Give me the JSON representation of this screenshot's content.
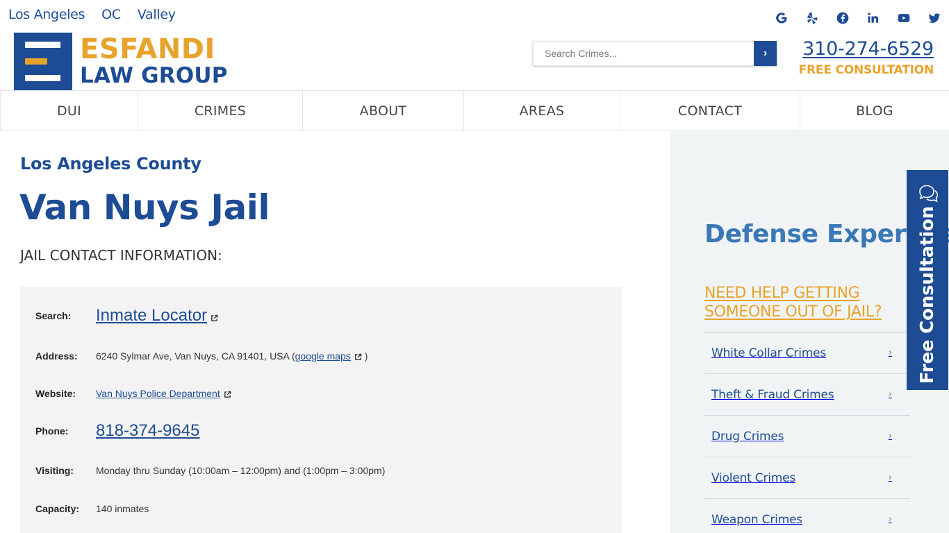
{
  "top_bar": {
    "regions": [
      "Los Angeles",
      "OC",
      "Valley"
    ],
    "social_icons": [
      "google-icon",
      "yelp-icon",
      "facebook-icon",
      "linkedin-icon",
      "youtube-icon",
      "twitter-icon"
    ]
  },
  "logo": {
    "line1": "ESFANDI",
    "line2": "LAW GROUP"
  },
  "search": {
    "placeholder": "Search Crimes...",
    "button_label": "›"
  },
  "contact": {
    "phone": "310-274-6529",
    "tagline": "FREE CONSULTATION"
  },
  "nav": {
    "items": [
      "DUI",
      "CRIMES",
      "ABOUT",
      "AREAS",
      "CONTACT",
      "BLOG"
    ]
  },
  "main": {
    "eyebrow": "Los Angeles County",
    "title": "Van Nuys Jail",
    "section_heading": "JAIL CONTACT INFORMATION:",
    "info": {
      "search_label": "Search:",
      "search_value": "Inmate Locator",
      "address_label": "Address:",
      "address_value": "6240 Sylmar Ave, Van Nuys, CA 91401, USA (",
      "address_link": "google maps",
      "address_close": ")",
      "website_label": "Website:",
      "website_value": "Van Nuys Police Department",
      "phone_label": "Phone:",
      "phone_value": "818-374-9645",
      "visiting_label": "Visiting:",
      "visiting_value": "Monday thru Sunday (10:00am – 12:00pm) and (1:00pm – 3:00pm)",
      "capacity_label": "Capacity:",
      "capacity_value": "140 inmates"
    }
  },
  "sidebar": {
    "title": "Defense Expertise",
    "cta": "NEED HELP GETTING SOMEONE OUT OF JAIL?",
    "items": [
      {
        "label": "White Collar Crimes",
        "chevron": "›"
      },
      {
        "label": "Theft & Fraud Crimes",
        "chevron": "›"
      },
      {
        "label": "Drug Crimes",
        "chevron": "›"
      },
      {
        "label": "Violent Crimes",
        "chevron": "›"
      },
      {
        "label": "Weapon Crimes",
        "chevron": "›"
      }
    ]
  },
  "floating_tab": {
    "label": "Free Consultation"
  },
  "colors": {
    "brand_blue": "#1d4c94",
    "brand_gold": "#e8a32c",
    "sidebar_bg": "#f1f4f4",
    "info_bg": "#f3f3f3"
  }
}
